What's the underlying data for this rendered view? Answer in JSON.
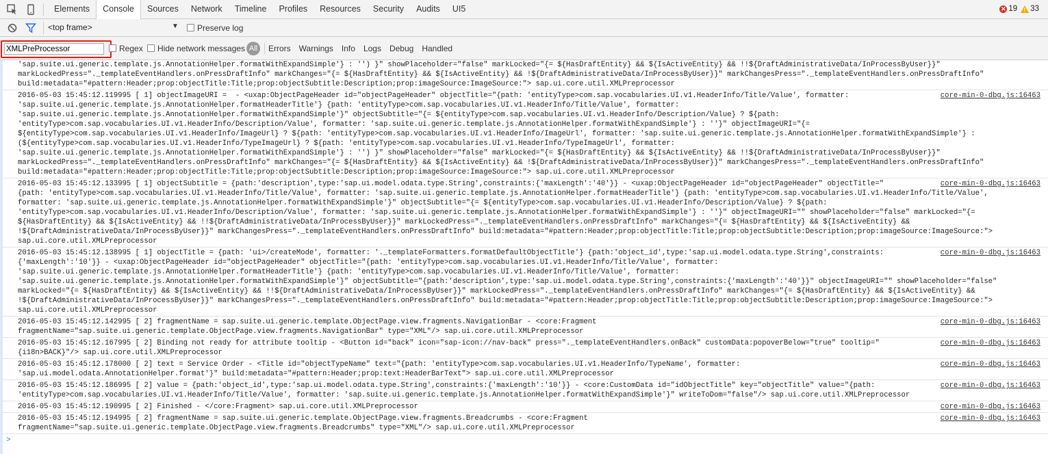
{
  "tabs": [
    "Elements",
    "Console",
    "Sources",
    "Network",
    "Timeline",
    "Profiles",
    "Resources",
    "Security",
    "Audits",
    "UI5"
  ],
  "counts": {
    "errors": "19",
    "warnings": "33"
  },
  "frame": {
    "selected": "<top frame>",
    "preserve_log": "Preserve log"
  },
  "filter": {
    "value": "XMLPreProcessor",
    "regex": "Regex",
    "hide_network": "Hide network messages",
    "all": "All",
    "levels": [
      "Errors",
      "Warnings",
      "Info",
      "Logs",
      "Debug",
      "Handled"
    ]
  },
  "colors": {
    "highlight": "#e41c1c",
    "error": "#d93025",
    "warning": "#f2a900"
  },
  "messages": [
    {
      "text": "'sap.suite.ui.generic.template.js.AnnotationHelper.formatWithExpandSimple'} : '') }\" showPlaceholder=\"false\" markLocked=\"{= ${HasDraftEntity} && ${IsActiveEntity} && !!${DraftAdministrativeData/InProcessByUser}}\"\nmarkLockedPress=\"._templateEventHandlers.onPressDraftInfo\" markChanges=\"{= ${HasDraftEntity} && ${IsActiveEntity} && !${DraftAdministrativeData/InProcessByUser}}\" markChangesPress=\"._templateEventHandlers.onPressDraftInfo\"\nbuild:metadata=\"#pattern:Header;prop:objectTitle:Title;prop:objectSubtitle:Description;prop:imageSource:ImageSource:\"> sap.ui.core.util.XMLPreprocessor",
      "source": ""
    },
    {
      "text": "2016-05-03 15:45:12.119995 [ 1] objectImageURI =  - <uxap:ObjectPageHeader id=\"objectPageHeader\" objectTitle=\"{path: 'entityType>com.sap.vocabularies.UI.v1.HeaderInfo/Title/Value', formatter:\n'sap.suite.ui.generic.template.js.AnnotationHelper.formatHeaderTitle'} {path: 'entityType>com.sap.vocabularies.UI.v1.HeaderInfo/Title/Value', formatter:\n'sap.suite.ui.generic.template.js.AnnotationHelper.formatWithExpandSimple'}\" objectSubtitle=\"{= ${entityType>com.sap.vocabularies.UI.v1.HeaderInfo/Description/Value} ? ${path:\n'entityType>com.sap.vocabularies.UI.v1.HeaderInfo/Description/Value', formatter: 'sap.suite.ui.generic.template.js.AnnotationHelper.formatWithExpandSimple'} : ''}\" objectImageURI=\"{=\n${entityType>com.sap.vocabularies.UI.v1.HeaderInfo/ImageUrl} ? ${path: 'entityType>com.sap.vocabularies.UI.v1.HeaderInfo/ImageUrl', formatter: 'sap.suite.ui.generic.template.js.AnnotationHelper.formatWithExpandSimple'} :\n(${entityType>com.sap.vocabularies.UI.v1.HeaderInfo/TypeImageUrl} ? ${path: 'entityType>com.sap.vocabularies.UI.v1.HeaderInfo/TypeImageUrl', formatter:\n'sap.suite.ui.generic.template.js.AnnotationHelper.formatWithExpandSimple'} : '') }\" showPlaceholder=\"false\" markLocked=\"{= ${HasDraftEntity} && ${IsActiveEntity} && !!${DraftAdministrativeData/InProcessByUser}}\"\nmarkLockedPress=\"._templateEventHandlers.onPressDraftInfo\" markChanges=\"{= ${HasDraftEntity} && ${IsActiveEntity} && !${DraftAdministrativeData/InProcessByUser}}\" markChangesPress=\"._templateEventHandlers.onPressDraftInfo\"\nbuild:metadata=\"#pattern:Header;prop:objectTitle:Title;prop:objectSubtitle:Description;prop:imageSource:ImageSource:\"> sap.ui.core.util.XMLPreprocessor",
      "source": "core-min-0-dbg.js:16463"
    },
    {
      "text": "2016-05-03 15:45:12.133995 [ 1] objectSubtitle = {path:'description',type:'sap.ui.model.odata.type.String',constraints:{'maxLength':'40'}} - <uxap:ObjectPageHeader id=\"objectPageHeader\" objectTitle=\"\n{path: 'entityType>com.sap.vocabularies.UI.v1.HeaderInfo/Title/Value', formatter: 'sap.suite.ui.generic.template.js.AnnotationHelper.formatHeaderTitle'} {path: 'entityType>com.sap.vocabularies.UI.v1.HeaderInfo/Title/Value',\nformatter: 'sap.suite.ui.generic.template.js.AnnotationHelper.formatWithExpandSimple'}\" objectSubtitle=\"{= ${entityType>com.sap.vocabularies.UI.v1.HeaderInfo/Description/Value} ? ${path:\n'entityType>com.sap.vocabularies.UI.v1.HeaderInfo/Description/Value', formatter: 'sap.suite.ui.generic.template.js.AnnotationHelper.formatWithExpandSimple'} : ''}\" objectImageURI=\"\" showPlaceholder=\"false\" markLocked=\"{=\n${HasDraftEntity} && ${IsActiveEntity} && !!${DraftAdministrativeData/InProcessByUser}}\" markLockedPress=\"._templateEventHandlers.onPressDraftInfo\" markChanges=\"{= ${HasDraftEntity} && ${IsActiveEntity} &&\n!${DraftAdministrativeData/InProcessByUser}}\" markChangesPress=\"._templateEventHandlers.onPressDraftInfo\" build:metadata=\"#pattern:Header;prop:objectTitle:Title;prop:objectSubtitle:Description;prop:imageSource:ImageSource:\">\nsap.ui.core.util.XMLPreprocessor",
      "source": "core-min-0-dbg.js:16463"
    },
    {
      "text": "2016-05-03 15:45:12.138995 [ 1] objectTitle = {path: 'ui>/createMode', formatter: '._templateFormatters.formatDefaultObjectTitle'} {path:'object_id',type:'sap.ui.model.odata.type.String',constraints:\n{'maxLength':'10'}} - <uxap:ObjectPageHeader id=\"objectPageHeader\" objectTitle=\"{path: 'entityType>com.sap.vocabularies.UI.v1.HeaderInfo/Title/Value', formatter:\n'sap.suite.ui.generic.template.js.AnnotationHelper.formatHeaderTitle'} {path: 'entityType>com.sap.vocabularies.UI.v1.HeaderInfo/Title/Value', formatter:\n'sap.suite.ui.generic.template.js.AnnotationHelper.formatWithExpandSimple'}\" objectSubtitle=\"{path:'description',type:'sap.ui.model.odata.type.String',constraints:{'maxLength':'40'}}\" objectImageURI=\"\" showPlaceholder=\"false\"\nmarkLocked=\"{= ${HasDraftEntity} && ${IsActiveEntity} && !!${DraftAdministrativeData/InProcessByUser}}\" markLockedPress=\"._templateEventHandlers.onPressDraftInfo\" markChanges=\"{= ${HasDraftEntity} && ${IsActiveEntity} &&\n!${DraftAdministrativeData/InProcessByUser}}\" markChangesPress=\"._templateEventHandlers.onPressDraftInfo\" build:metadata=\"#pattern:Header;prop:objectTitle:Title;prop:objectSubtitle:Description;prop:imageSource:ImageSource:\">\nsap.ui.core.util.XMLPreprocessor",
      "source": "core-min-0-dbg.js:16463"
    },
    {
      "text": "2016-05-03 15:45:12.142995 [ 2] fragmentName = sap.suite.ui.generic.template.ObjectPage.view.fragments.NavigationBar - <core:Fragment\nfragmentName=\"sap.suite.ui.generic.template.ObjectPage.view.fragments.NavigationBar\" type=\"XML\"/> sap.ui.core.util.XMLPreprocessor",
      "source": "core-min-0-dbg.js:16463"
    },
    {
      "text": "2016-05-03 15:45:12.167995 [ 2] Binding not ready for attribute tooltip - <Button id=\"back\" icon=\"sap-icon://nav-back\" press=\"._templateEventHandlers.onBack\" customData:popoverBelow=\"true\" tooltip=\"\n{i18n>BACK}\"/> sap.ui.core.util.XMLPreprocessor",
      "source": "core-min-0-dbg.js:16463"
    },
    {
      "text": "2016-05-03 15:45:12.178000 [ 2] text = Service Order - <Title id=\"objectTypeName\" text=\"{path: 'entityType>com.sap.vocabularies.UI.v1.HeaderInfo/TypeName', formatter:\n'sap.ui.model.odata.AnnotationHelper.format'}\" build:metadata=\"#pattern:Header;prop:text:HeaderBarText\"> sap.ui.core.util.XMLPreprocessor",
      "source": "core-min-0-dbg.js:16463"
    },
    {
      "text": "2016-05-03 15:45:12.186995 [ 2] value = {path:'object_id',type:'sap.ui.model.odata.type.String',constraints:{'maxLength':'10'}} - <core:CustomData id=\"idObjectTitle\" key=\"objectTitle\" value=\"{path:\n'entityType>com.sap.vocabularies.UI.v1.HeaderInfo/Title/Value', formatter: 'sap.suite.ui.generic.template.js.AnnotationHelper.formatWithExpandSimple'}\" writeToDom=\"false\"/> sap.ui.core.util.XMLPreprocessor",
      "source": "core-min-0-dbg.js:16463"
    },
    {
      "text": "2016-05-03 15:45:12.190995 [ 2] Finished - </core:Fragment> sap.ui.core.util.XMLPreprocessor",
      "source": "core-min-0-dbg.js:16463"
    },
    {
      "text": "2016-05-03 15:45:12.194995 [ 2] fragmentName = sap.suite.ui.generic.template.ObjectPage.view.fragments.Breadcrumbs - <core:Fragment\nfragmentName=\"sap.suite.ui.generic.template.ObjectPage.view.fragments.Breadcrumbs\" type=\"XML\"/> sap.ui.core.util.XMLPreprocessor",
      "source": "core-min-0-dbg.js:16463"
    }
  ]
}
